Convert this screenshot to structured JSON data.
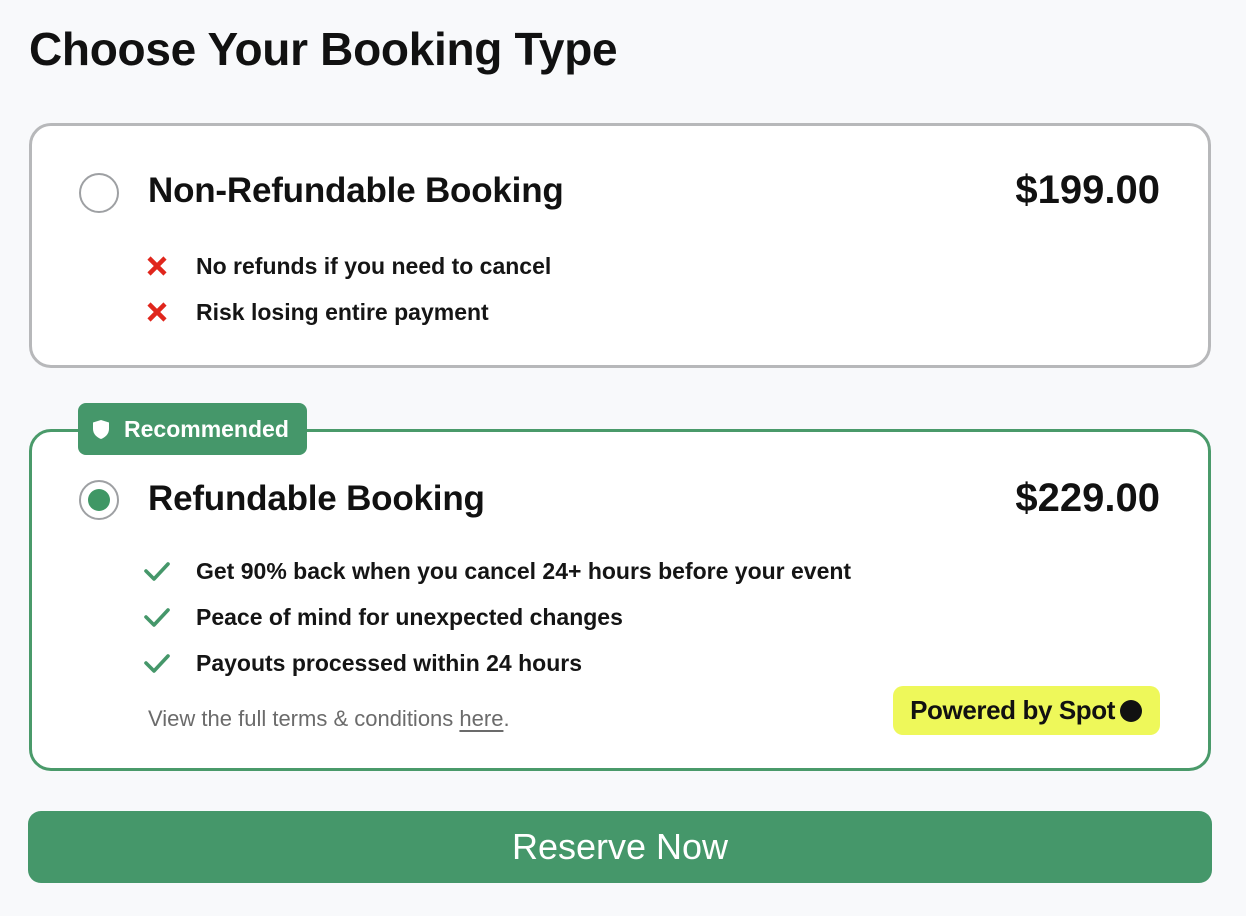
{
  "page": {
    "title": "Choose Your Booking Type"
  },
  "options": {
    "non_refundable": {
      "title": "Non-Refundable Booking",
      "price": "$199.00",
      "selected": false,
      "features": [
        {
          "icon": "x-icon",
          "text": "No refunds if you need to cancel"
        },
        {
          "icon": "x-icon",
          "text": "Risk losing entire payment"
        }
      ]
    },
    "refundable": {
      "badge": "Recommended",
      "badge_icon": "shield-icon",
      "title": "Refundable Booking",
      "price": "$229.00",
      "selected": true,
      "features": [
        {
          "icon": "check-icon",
          "text": "Get 90% back when you cancel 24+ hours before your event"
        },
        {
          "icon": "check-icon",
          "text": "Peace of mind for unexpected changes"
        },
        {
          "icon": "check-icon",
          "text": "Payouts processed within 24 hours"
        }
      ],
      "terms_prefix": "View the full terms & conditions ",
      "terms_link": "here",
      "terms_suffix": ".",
      "powered_by": "Powered by Spot"
    }
  },
  "actions": {
    "reserve_label": "Reserve Now"
  },
  "colors": {
    "accent_green": "#45976a",
    "x_red": "#e0261c",
    "powered_bg": "#eef85a",
    "nonref_border": "#b7b8ba"
  }
}
